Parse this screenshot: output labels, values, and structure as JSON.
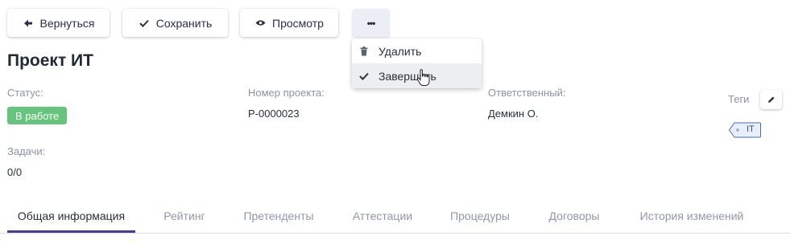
{
  "toolbar": {
    "back_label": "Вернуться",
    "save_label": "Сохранить",
    "view_label": "Просмотр",
    "more_label": "•••"
  },
  "dropdown": {
    "items": [
      {
        "label": "Удалить",
        "icon": "trash-icon"
      },
      {
        "label": "Завершить",
        "icon": "check-icon"
      }
    ]
  },
  "project": {
    "title": "Проект ИТ",
    "status_label": "Статус:",
    "status_value": "В работе",
    "number_label": "Номер проекта:",
    "number_value": "P-0000023",
    "owner_label": "Ответственный:",
    "owner_value": "Демкин О.",
    "tags_label": "Теги",
    "tags": [
      "IT"
    ],
    "tasks_label": "Задачи:",
    "tasks_value": "0/0"
  },
  "tabs": [
    {
      "label": "Общая информация"
    },
    {
      "label": "Рейтинг"
    },
    {
      "label": "Претенденты"
    },
    {
      "label": "Аттестации"
    },
    {
      "label": "Процедуры"
    },
    {
      "label": "Договоры"
    },
    {
      "label": "История изменений"
    }
  ],
  "colors": {
    "status_badge": "#66c47c",
    "tab_active_ink": "#4b3a9a",
    "more_button_bg": "#eceef6"
  }
}
